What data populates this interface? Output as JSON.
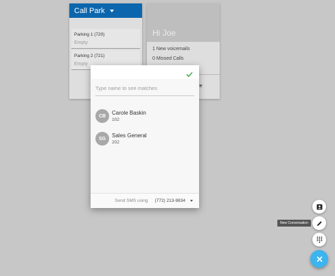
{
  "call_park": {
    "title": "Call Park",
    "slots": [
      {
        "name": "Parking 1 (720)",
        "value": "Empty"
      },
      {
        "name": "Parking 2 (721)",
        "value": "Empty"
      }
    ]
  },
  "user_card": {
    "greeting": "Hi Joe",
    "voicemails": "1 New voicemails",
    "missed_calls": "0 Missed Calls",
    "truncated_text": "le"
  },
  "dialog": {
    "search_placeholder": "Type name to see matches",
    "contacts": [
      {
        "initials": "CB",
        "name": "Carole Baskin",
        "ext": "102"
      },
      {
        "initials": "SG",
        "name": "Sales General",
        "ext": "202"
      }
    ],
    "footer": {
      "label": "Send SMS using",
      "phone": "(772) 213-9834"
    }
  },
  "fab": {
    "tooltip": "New Conversation",
    "accent": "#3cb4ef"
  },
  "colors": {
    "header_blue": "#0b66ad",
    "check_green": "#4caf50"
  }
}
